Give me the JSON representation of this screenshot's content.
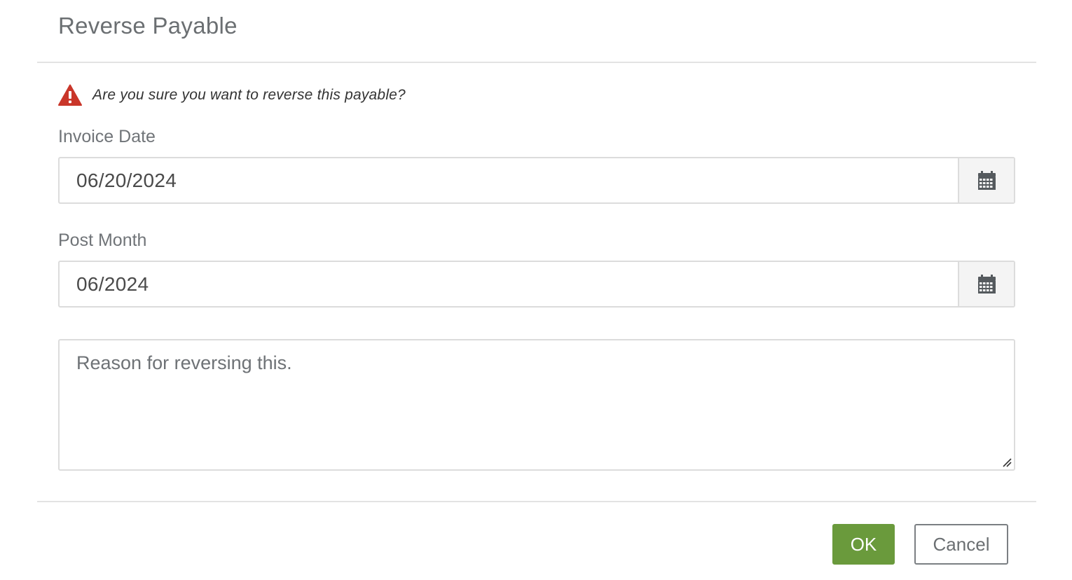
{
  "dialog": {
    "title": "Reverse Payable",
    "warning_icon": "warning-triangle-icon",
    "warning_color": "#c9362a",
    "warning_text": "Are you sure you want to reverse this payable?"
  },
  "fields": {
    "invoice_date": {
      "label": "Invoice Date",
      "value": "06/20/2024",
      "icon": "calendar-icon"
    },
    "post_month": {
      "label": "Post Month",
      "value": "06/2024",
      "icon": "calendar-icon"
    },
    "reason": {
      "placeholder": "Reason for reversing this."
    }
  },
  "buttons": {
    "ok_label": "OK",
    "cancel_label": "Cancel",
    "ok_color": "#6a9a3c"
  }
}
